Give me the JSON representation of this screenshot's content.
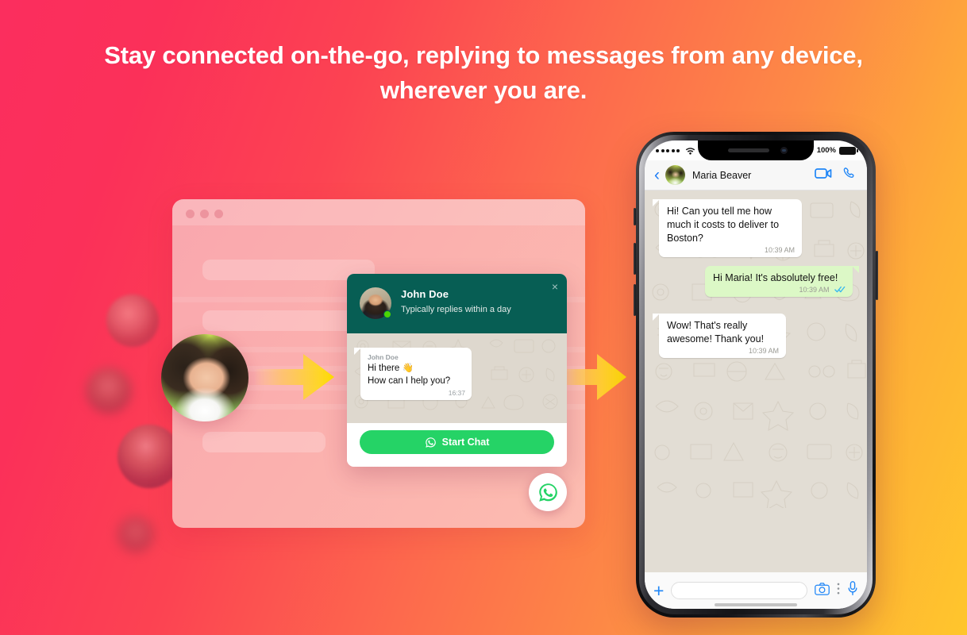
{
  "headline": "Stay connected on-the-go, replying to messages from any device, wherever you are.",
  "colors": {
    "gradient_start": "#fb2e5e",
    "gradient_end": "#ffc62c",
    "whatsapp_green": "#25d366",
    "whatsapp_dark_green": "#075e54",
    "arrow_yellow": "#ffe000",
    "outgoing_bubble": "#dcf8c6",
    "chat_background": "#e2ddd4",
    "ios_blue": "#1f7ef6",
    "online_dot": "#4ad504"
  },
  "browser_mockup": {
    "window_dots": [
      "dot-red",
      "dot-yellow",
      "dot-green"
    ]
  },
  "widget": {
    "agent_name": "John Doe",
    "agent_status": "Typically replies within a day",
    "close_label": "×",
    "message": {
      "sender": "John Doe",
      "line1": "Hi there 👋",
      "line2": "How can I help you?",
      "time": "16:37"
    },
    "cta_label": "Start Chat",
    "cta_icon": "whatsapp-icon",
    "fab_icon": "whatsapp-icon"
  },
  "phone": {
    "status_bar": {
      "signal": "•••••",
      "wifi_icon": "wifi-icon",
      "battery_percent": "100%",
      "battery_icon": "battery-full-icon"
    },
    "chat_header": {
      "back_icon": "chevron-left-icon",
      "contact_name": "Maria Beaver",
      "video_icon": "video-call-icon",
      "call_icon": "phone-call-icon"
    },
    "messages": [
      {
        "direction": "incoming",
        "text": "Hi! Can you tell me how much it costs to deliver to Boston?",
        "time": "10:39 AM",
        "status": ""
      },
      {
        "direction": "outgoing",
        "text": "Hi Maria! It's absolutely free!",
        "time": "10:39 AM",
        "status": "read-receipt-double-check"
      },
      {
        "direction": "incoming",
        "text": "Wow! That's really awesome! Thank you!",
        "time": "10:39 AM",
        "status": ""
      }
    ],
    "input_bar": {
      "plus_icon": "plus-icon",
      "placeholder": "",
      "camera_icon": "camera-icon",
      "more_icon": "more-vertical-icon",
      "mic_icon": "microphone-icon"
    }
  },
  "arrows": [
    {
      "name": "arrow-avatar-to-browser"
    },
    {
      "name": "arrow-browser-to-phone"
    }
  ]
}
